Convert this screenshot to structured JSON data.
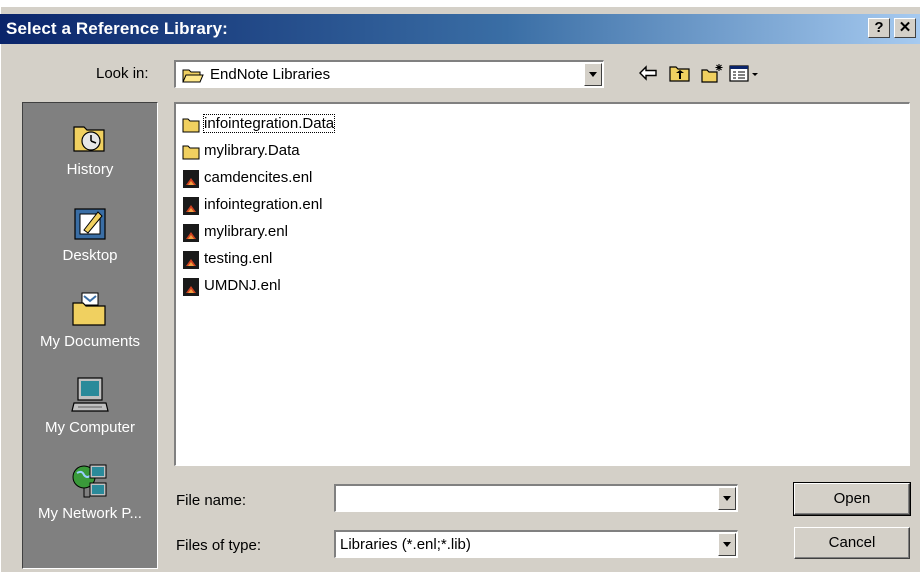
{
  "window": {
    "title": "Select a Reference Library:",
    "help_label": "?",
    "close_label": "✕"
  },
  "look_in": {
    "label": "Look in:",
    "value": "EndNote Libraries"
  },
  "toolbar": {
    "back_icon": "back-arrow-icon",
    "up_icon": "up-folder-icon",
    "new_folder_icon": "new-folder-icon",
    "view_icon": "view-menu-icon"
  },
  "places": [
    {
      "label": "History",
      "icon": "history-icon"
    },
    {
      "label": "Desktop",
      "icon": "desktop-icon"
    },
    {
      "label": "My Documents",
      "icon": "my-documents-icon"
    },
    {
      "label": "My Computer",
      "icon": "my-computer-icon"
    },
    {
      "label": "My Network P...",
      "icon": "my-network-places-icon"
    }
  ],
  "files": [
    {
      "name": "infointegration.Data",
      "type": "folder"
    },
    {
      "name": "mylibrary.Data",
      "type": "folder"
    },
    {
      "name": "camdencites.enl",
      "type": "enl"
    },
    {
      "name": "infointegration.enl",
      "type": "enl"
    },
    {
      "name": "mylibrary.enl",
      "type": "enl"
    },
    {
      "name": "testing.enl",
      "type": "enl"
    },
    {
      "name": "UMDNJ.enl",
      "type": "enl"
    }
  ],
  "file_name": {
    "label": "File name:",
    "value": ""
  },
  "file_type": {
    "label": "Files of type:",
    "value": "Libraries (*.enl;*.lib)"
  },
  "buttons": {
    "open": "Open",
    "cancel": "Cancel"
  },
  "colors": {
    "title_start": "#0a246a",
    "title_end": "#a6caf0",
    "face": "#d4d0c8",
    "places_bg": "#808080"
  }
}
